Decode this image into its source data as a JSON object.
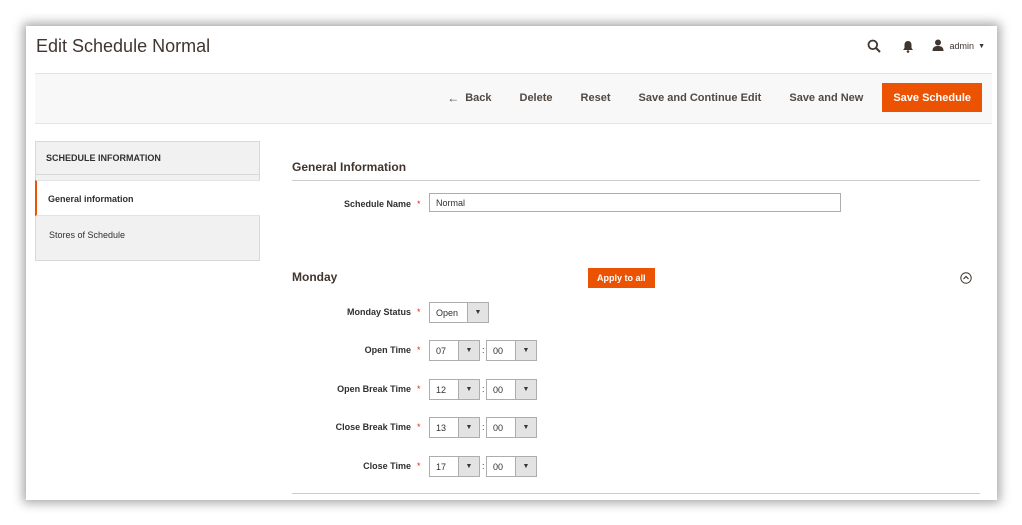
{
  "page": {
    "title": "Edit Schedule Normal"
  },
  "header": {
    "user": "admin",
    "icons": [
      "search-icon",
      "bell-icon",
      "user-icon"
    ]
  },
  "actions": {
    "back": "Back",
    "delete": "Delete",
    "reset": "Reset",
    "save_continue": "Save and Continue Edit",
    "save_new": "Save and New",
    "save": "Save Schedule"
  },
  "sidebar": {
    "heading": "SCHEDULE INFORMATION",
    "items": [
      {
        "label": "General information",
        "active": true
      },
      {
        "label": "Stores of Schedule",
        "active": false
      }
    ]
  },
  "general": {
    "title": "General Information",
    "schedule_name_label": "Schedule Name",
    "schedule_name_value": "Normal"
  },
  "monday": {
    "title": "Monday",
    "apply_label": "Apply to all",
    "status_label": "Monday Status",
    "status_value": "Open",
    "open_time_label": "Open Time",
    "open_time": {
      "hour": "07",
      "minute": "00"
    },
    "open_break_label": "Open Break Time",
    "open_break": {
      "hour": "12",
      "minute": "00"
    },
    "close_break_label": "Close Break Time",
    "close_break": {
      "hour": "13",
      "minute": "00"
    },
    "close_time_label": "Close Time",
    "close_time": {
      "hour": "17",
      "minute": "00"
    }
  },
  "colors": {
    "accent": "#eb5202",
    "required": "#e22626"
  }
}
